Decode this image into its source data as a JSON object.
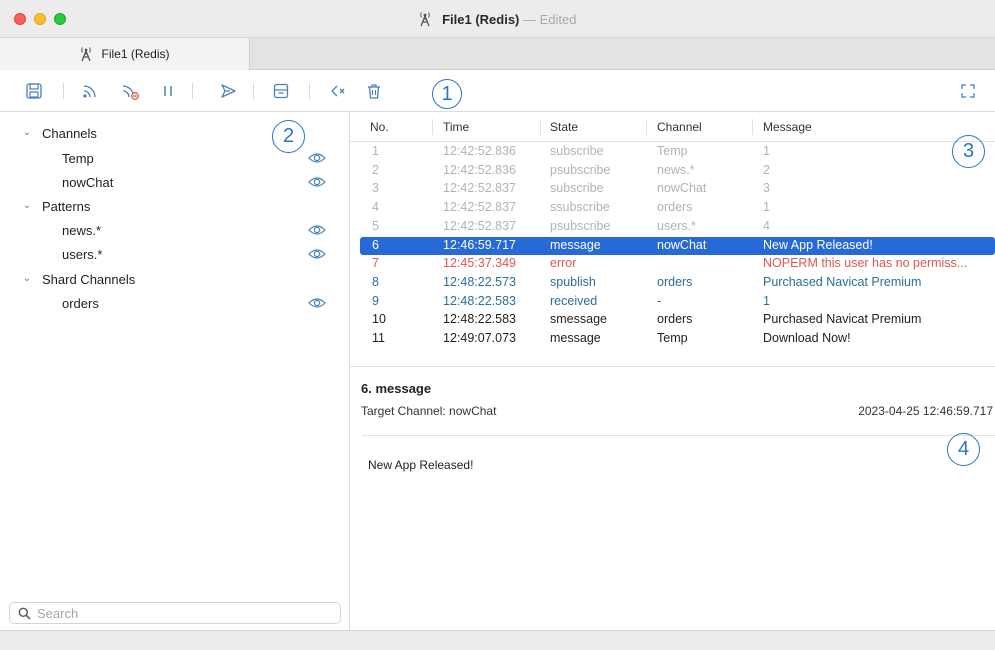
{
  "window": {
    "title": "File1 (Redis)",
    "separator": "—",
    "status": "Edited"
  },
  "tab": {
    "label": "File1 (Redis)"
  },
  "toolbar": {
    "buttons": [
      "save-icon",
      "subscribe-icon",
      "unsubscribe-icon",
      "pause-icon",
      "publish-icon",
      "archive-icon",
      "mute-icon",
      "trash-icon",
      "fullscreen-icon"
    ]
  },
  "callouts": {
    "c1": "1",
    "c2": "2",
    "c3": "3",
    "c4": "4"
  },
  "sidebar": {
    "groups": [
      {
        "label": "Channels",
        "items": [
          {
            "label": "Temp"
          },
          {
            "label": "nowChat"
          }
        ]
      },
      {
        "label": "Patterns",
        "items": [
          {
            "label": "news.*"
          },
          {
            "label": "users.*"
          }
        ]
      },
      {
        "label": "Shard Channels",
        "items": [
          {
            "label": "orders"
          }
        ]
      }
    ],
    "search_placeholder": "Search"
  },
  "table": {
    "headers": {
      "no": "No.",
      "time": "Time",
      "state": "State",
      "channel": "Channel",
      "message": "Message"
    },
    "rows": [
      {
        "no": "1",
        "time": "12:42:52.836",
        "state": "subscribe",
        "channel": "Temp",
        "message": "1",
        "style": "muted"
      },
      {
        "no": "2",
        "time": "12:42:52.836",
        "state": "psubscribe",
        "channel": "news.*",
        "message": "2",
        "style": "muted"
      },
      {
        "no": "3",
        "time": "12:42:52.837",
        "state": "subscribe",
        "channel": "nowChat",
        "message": "3",
        "style": "muted"
      },
      {
        "no": "4",
        "time": "12:42:52.837",
        "state": "ssubscribe",
        "channel": "orders",
        "message": "1",
        "style": "muted"
      },
      {
        "no": "5",
        "time": "12:42:52.837",
        "state": "psubscribe",
        "channel": "users.*",
        "message": "4",
        "style": "muted"
      },
      {
        "no": "6",
        "time": "12:46:59.717",
        "state": "message",
        "channel": "nowChat",
        "message": "New App Released!",
        "style": "selected"
      },
      {
        "no": "7",
        "time": "12:45:37.349",
        "state": "error",
        "channel": "",
        "message": "NOPERM this user has no permiss...",
        "style": "error"
      },
      {
        "no": "8",
        "time": "12:48:22.573",
        "state": "spublish",
        "channel": "orders",
        "message": "Purchased Navicat Premium",
        "style": "info"
      },
      {
        "no": "9",
        "time": "12:48:22.583",
        "state": "received",
        "channel": "-",
        "message": "1",
        "style": "info"
      },
      {
        "no": "10",
        "time": "12:48:22.583",
        "state": "smessage",
        "channel": "orders",
        "message": "Purchased Navicat Premium",
        "style": "normal"
      },
      {
        "no": "11",
        "time": "12:49:07.073",
        "state": "message",
        "channel": "Temp",
        "message": "Download Now!",
        "style": "normal"
      }
    ]
  },
  "detail": {
    "title": "6. message",
    "target": "Target Channel: nowChat",
    "timestamp": "2023-04-25 12:46:59.717",
    "body": "New App Released!"
  },
  "colors": {
    "accent": "#2869d8",
    "muted": "#b3b3b3",
    "error": "#e0574f",
    "info": "#2a6f97",
    "normal": "#1f1f1f",
    "callout": "#2a74c8",
    "icon": "#4a7fb8"
  }
}
